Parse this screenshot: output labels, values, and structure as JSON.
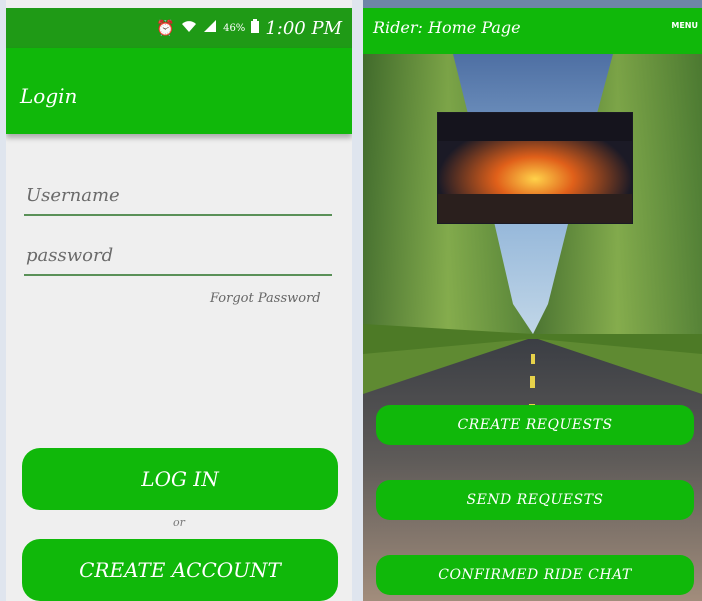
{
  "status_bar": {
    "alarm_icon": "alarm-clock-icon",
    "wifi_icon": "wifi-icon",
    "signal_icon": "signal-icon",
    "battery_percent": "46%",
    "battery_icon": "battery-icon",
    "time": "1:00 PM"
  },
  "login": {
    "title": "Login",
    "username_placeholder": "Username",
    "password_placeholder": "password",
    "forgot_password": "Forgot Password",
    "login_button": "LOG IN",
    "or": "or",
    "create_account_button": "CREATE ACCOUNT"
  },
  "rider": {
    "title": "Rider: Home Page",
    "menu": "MENU",
    "create_requests": "CREATE REQUESTS",
    "send_requests": "SEND REQUESTS",
    "confirmed_ride_chat": "CONFIRMED RIDE CHAT"
  },
  "colors": {
    "app_green": "#10b80a",
    "status_green": "#1f9a16",
    "background": "#efefef"
  }
}
